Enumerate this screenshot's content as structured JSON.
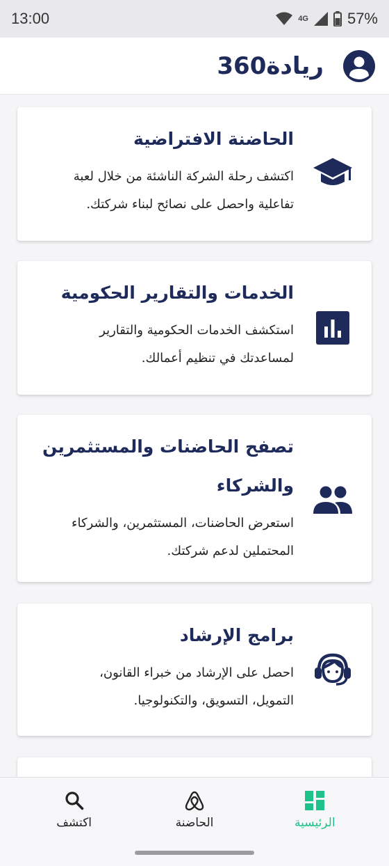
{
  "status_bar": {
    "time": "13:00",
    "network": "4G",
    "battery": "57%"
  },
  "app_bar": {
    "title": "ريادة360",
    "avatar_icon": "account-circle-icon"
  },
  "cards": [
    {
      "title": "الحاضنة الافتراضية",
      "desc_line1": "اكتشف رحلة الشركة الناشئة من خلال لعبة",
      "desc_line2": "تفاعلية واحصل على نصائح لبناء شركتك.",
      "icon": "graduation-cap-icon"
    },
    {
      "title": "الخدمات والتقارير الحكومية",
      "desc_line1": "استكشف الخدمات الحكومية والتقارير",
      "desc_line2": "لمساعدتك في تنظيم أعمالك.",
      "icon": "bar-chart-icon"
    },
    {
      "title_line1": "تصفح الحاضنات والمستثمرين",
      "title_line2": "والشركاء",
      "desc_line1": "استعرض الحاضنات، المستثمرين، والشركاء",
      "desc_line2": "المحتملين لدعم شركتك.",
      "icon": "people-icon"
    },
    {
      "title": "برامج الإرشاد",
      "desc_line1": "احصل على الإرشاد من خبراء القانون،",
      "desc_line2": "التمويل، التسويق، والتكنولوجيا.",
      "icon": "headset-support-icon"
    }
  ],
  "bottom_nav": {
    "items": [
      {
        "label": "الرئيسية",
        "icon": "dashboard-icon",
        "active": true
      },
      {
        "label": "الحاضنة",
        "icon": "airbnb-icon",
        "active": false
      },
      {
        "label": "اكتشف",
        "icon": "search-icon",
        "active": false
      }
    ]
  },
  "colors": {
    "primary": "#1e2a5a",
    "accent": "#1ec38a",
    "background": "#f5f5f7",
    "card": "#ffffff"
  }
}
